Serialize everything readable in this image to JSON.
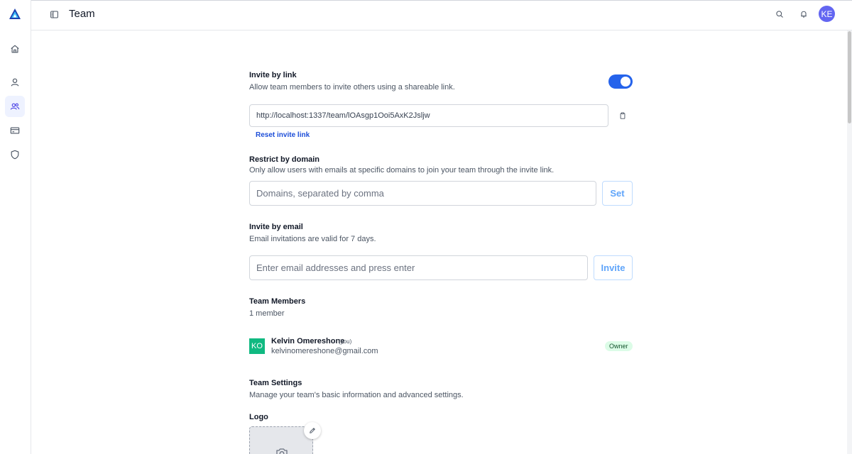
{
  "header": {
    "title": "Team",
    "user_initials": "KE"
  },
  "sidebar": {
    "items": [
      {
        "name": "home",
        "icon": "home-icon",
        "active": false
      },
      {
        "name": "account",
        "icon": "user-icon",
        "active": false
      },
      {
        "name": "team",
        "icon": "users-icon",
        "active": true
      },
      {
        "name": "billing",
        "icon": "credit-card-icon",
        "active": false
      },
      {
        "name": "security",
        "icon": "shield-icon",
        "active": false
      }
    ]
  },
  "invite_link": {
    "heading": "Invite by link",
    "description": "Allow team members to invite others using a shareable link.",
    "enabled": true,
    "url": "http://localhost:1337/team/lOAsgp1Ooi5AxK2Jsljw",
    "reset_label": "Reset invite link"
  },
  "restrict_domain": {
    "heading": "Restrict by domain",
    "description": "Only allow users with emails at specific domains to join your team through the invite link.",
    "placeholder": "Domains, separated by comma",
    "button_label": "Set"
  },
  "invite_email": {
    "heading": "Invite by email",
    "description": "Email invitations are valid for 7 days.",
    "placeholder": "Enter email addresses and press enter",
    "button_label": "Invite"
  },
  "members": {
    "heading": "Team Members",
    "count_label": "1 member",
    "list": [
      {
        "initials": "KO",
        "name": "Kelvin Omereshone",
        "you_label": "(you)",
        "email": "kelvinomereshone@gmail.com",
        "role": "Owner"
      }
    ]
  },
  "settings": {
    "heading": "Team Settings",
    "description": "Manage your team's basic information and advanced settings.",
    "logo_label": "Logo"
  },
  "colors": {
    "accent": "#2563eb",
    "member_avatar": "#10b981",
    "user_avatar": "#6366f1",
    "owner_badge": "#dcfce7"
  }
}
